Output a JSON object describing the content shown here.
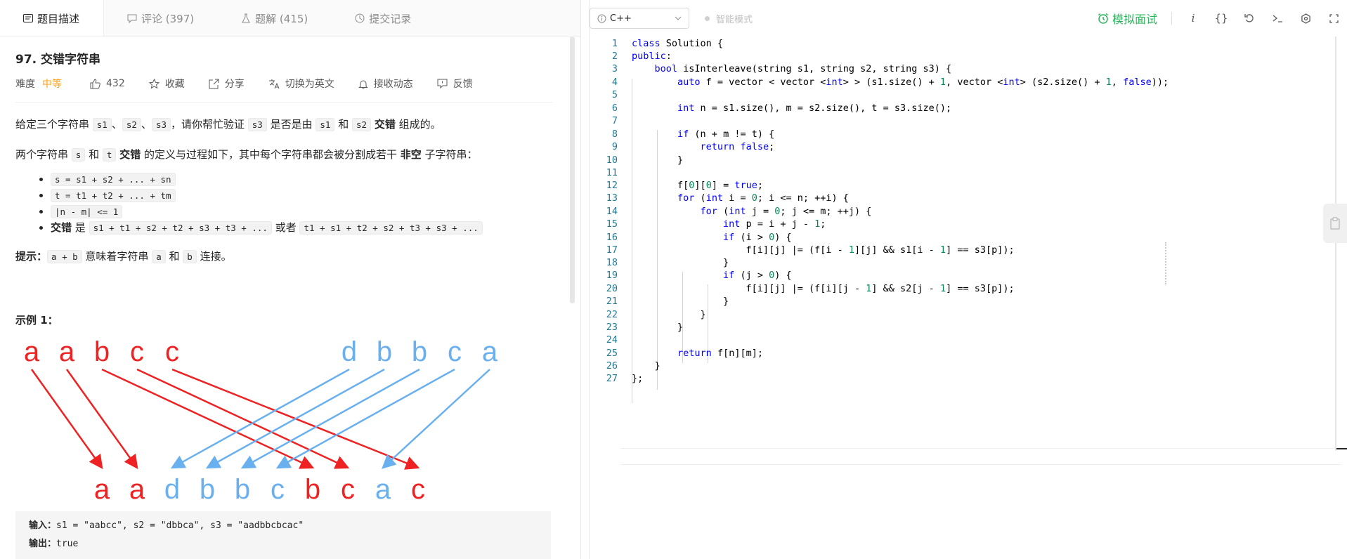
{
  "tabs": [
    {
      "label": "题目描述",
      "icon": "description-icon"
    },
    {
      "label": "评论 (397)",
      "icon": "comment-icon"
    },
    {
      "label": "题解 (415)",
      "icon": "flask-icon"
    },
    {
      "label": "提交记录",
      "icon": "history-icon"
    }
  ],
  "problem": {
    "title": "97. 交错字符串",
    "difficulty_label": "难度",
    "difficulty": "中等",
    "likes": "432",
    "favorite": "收藏",
    "share": "分享",
    "translate": "切换为英文",
    "subscribe": "接收动态",
    "feedback": "反馈"
  },
  "description": {
    "p1": [
      "给定三个字符串 ",
      "s1",
      "、",
      "s2",
      "、",
      "s3",
      "，请你帮忙验证 ",
      "s3",
      " 是否是由 ",
      "s1",
      " 和 ",
      "s2",
      " ",
      "交错",
      " 组成的。"
    ],
    "p2": [
      "两个字符串 ",
      "s",
      " 和 ",
      "t",
      " ",
      "交错",
      " 的定义与过程如下，其中每个字符串都会被分割成若干 ",
      "非空",
      " 子字符串："
    ],
    "bullets": {
      "b1": "s = s1 + s2 + ... + sn",
      "b2": "t = t1 + t2 + ... + tm",
      "b3": "|n - m| <= 1",
      "b4_label": "交错",
      "b4_is": " 是 ",
      "b4_a": "s1 + t1 + s2 + t2 + s3 + t3 + ...",
      "b4_or": " 或者 ",
      "b4_b": "t1 + s1 + t2 + s2 + t3 + s3 + ..."
    },
    "hint_label": "提示：",
    "hint": [
      "a + b",
      " 意味着字符串 ",
      "a",
      " 和 ",
      "b",
      " 连接。"
    ],
    "example_title": "示例 1："
  },
  "diagram": {
    "s1": [
      "a",
      "a",
      "b",
      "c",
      "c"
    ],
    "s2": [
      "d",
      "b",
      "b",
      "c",
      "a"
    ],
    "s3": [
      "a",
      "a",
      "d",
      "b",
      "b",
      "c",
      "b",
      "c",
      "a",
      "c"
    ],
    "colors": {
      "red": "#ee2222",
      "blue": "#6ab0ee"
    }
  },
  "example": {
    "input_label": "输入：",
    "input": "s1 = \"aabcc\", s2 = \"dbbca\", s3 = \"aadbbcbcac\"",
    "output_label": "输出：",
    "output": "true"
  },
  "toolbar": {
    "language": "C++",
    "smart_mode": "智能模式",
    "mock_interview": "模拟面试",
    "accent": "#2db55d"
  },
  "code": {
    "line_numbers": [
      "1",
      "2",
      "3",
      "4",
      "5",
      "6",
      "7",
      "8",
      "9",
      "10",
      "11",
      "12",
      "13",
      "14",
      "15",
      "16",
      "17",
      "18",
      "19",
      "20",
      "21",
      "22",
      "23",
      "24",
      "25",
      "26",
      "27"
    ]
  }
}
